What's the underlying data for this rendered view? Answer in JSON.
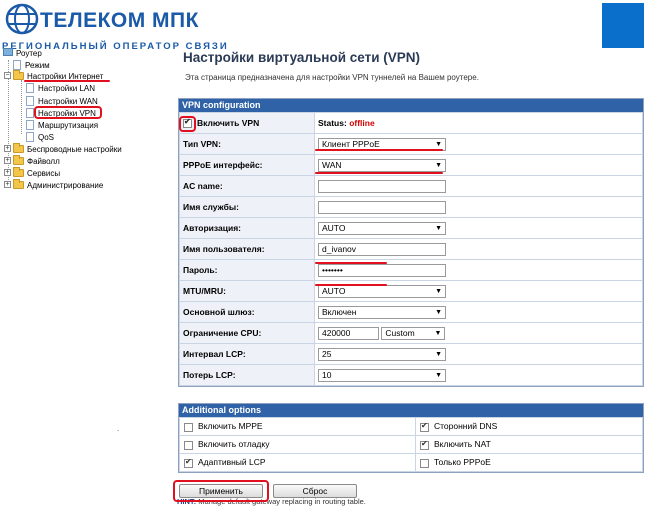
{
  "header": {
    "brand": "ТЕЛЕКОМ МПК",
    "tagline": "РЕГИОНАЛЬНЫЙ ОПЕРАТОР СВЯЗИ"
  },
  "sidebar": {
    "root": "Роутер",
    "items": [
      {
        "label": "Режим"
      },
      {
        "label": "Настройки Интернет"
      },
      {
        "label": "Настройки LAN"
      },
      {
        "label": "Настройки WAN"
      },
      {
        "label": "Настройки VPN"
      },
      {
        "label": "Маршрутизация"
      },
      {
        "label": "QoS"
      },
      {
        "label": "Беспроводные настройки"
      },
      {
        "label": "Файволл"
      },
      {
        "label": "Сервисы"
      },
      {
        "label": "Администрирование"
      }
    ]
  },
  "main": {
    "title": "Настройки виртуальной сети (VPN)",
    "description": "Эта страница предназначена для настройки VPN туннелей на Вашем роутере.",
    "vpn_config": {
      "heading": "VPN configuration",
      "enable_label": "Включить VPN",
      "status_label": "Status:",
      "status_value": "offline",
      "rows": {
        "vpn_type": {
          "label": "Тип VPN:",
          "value": "Клиент PPPoE"
        },
        "pppoe_iface": {
          "label": "PPPoE интерфейс:",
          "value": "WAN"
        },
        "ac_name": {
          "label": "AC name:",
          "value": ""
        },
        "service_name": {
          "label": "Имя службы:",
          "value": ""
        },
        "auth": {
          "label": "Авторизация:",
          "value": "AUTO"
        },
        "username": {
          "label": "Имя пользователя:",
          "value": "d_ivanov"
        },
        "password": {
          "label": "Пароль:",
          "value": "•••••••"
        },
        "mtu": {
          "label": "MTU/MRU:",
          "value": "AUTO"
        },
        "gateway": {
          "label": "Основной шлюз:",
          "value": "Включен"
        },
        "cpu_limit": {
          "label": "Ограничение CPU:",
          "value": "420000",
          "mode": "Custom"
        },
        "lcp_interval": {
          "label": "Интервал LCP:",
          "value": "25"
        },
        "lcp_loss": {
          "label": "Потерь LCP:",
          "value": "10"
        }
      }
    },
    "additional": {
      "heading": "Additional options",
      "options": {
        "mppe": {
          "label": "Включить MPPE",
          "checked": false
        },
        "third_dns": {
          "label": "Сторонний DNS",
          "checked": true
        },
        "debug": {
          "label": "Включить отладку",
          "checked": false
        },
        "nat": {
          "label": "Включить NAT",
          "checked": true
        },
        "adaptive_lcp": {
          "label": "Адаптивный LCP",
          "checked": true
        },
        "pppoe_only": {
          "label": "Только PPPoE",
          "checked": false
        }
      }
    },
    "buttons": {
      "apply": "Применить",
      "reset": "Сброс"
    },
    "hint": {
      "prefix": "HINT:",
      "text": "Manage default gateway replacing in routing table."
    }
  },
  "colors": {
    "panel_header": "#2f62a6",
    "brand_blue": "#1a5aa8",
    "status_offline": "#d40000",
    "annotation_red": "#e2101e"
  }
}
